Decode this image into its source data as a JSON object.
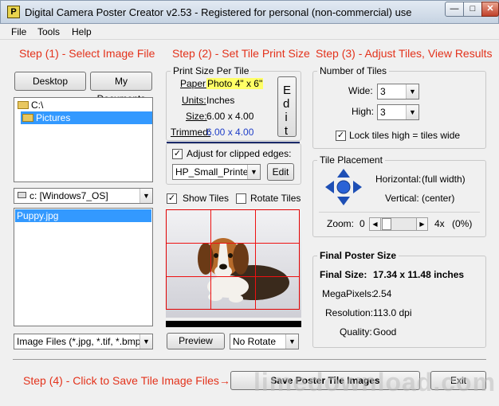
{
  "window": {
    "title": "Digital Camera Poster Creator v2.53 - Registered for personal (non-commercial) use",
    "icon_letter": "P"
  },
  "menu": [
    "File",
    "Tools",
    "Help"
  ],
  "steps": {
    "step1": "Step (1) - Select Image File",
    "step2": "Step (2) - Set Tile Print Size",
    "step3": "Step (3) - Adjust Tiles, View Results",
    "step4": "Step (4) - Click to Save Tile Image Files→"
  },
  "step1": {
    "desktop_button": "Desktop",
    "mydocs_button": "My Documents",
    "tree": [
      {
        "label": "C:\\",
        "selected": false
      },
      {
        "label": "Pictures",
        "selected": true
      }
    ],
    "drive": "c: [Windows7_OS]",
    "files": [
      "Puppy.jpg"
    ],
    "filter": "Image Files (*.jpg, *.tif, *.bmp)"
  },
  "step2": {
    "group_title": "Print Size Per Tile",
    "paper_label": "Paper:",
    "paper_value": "Photo 4\" x 6\"",
    "units_label": "Units:",
    "units_value": "Inches",
    "size_label": "Size:",
    "size_value": "6.00 x 4.00",
    "trimmed_label": "Trimmed:",
    "trimmed_value": "6.00 x 4.00",
    "edit_vertical": "Edit",
    "adjust_label": "Adjust for clipped edges:",
    "adjust_checked": true,
    "printer": "HP_Small_Printer",
    "printer_edit": "Edit",
    "show_tiles_label": "Show Tiles",
    "show_tiles_checked": true,
    "rotate_tiles_label": "Rotate Tiles",
    "rotate_tiles_checked": false,
    "preview_button": "Preview",
    "rotate_select": "No Rotate"
  },
  "step3": {
    "tiles_group": "Number of Tiles",
    "wide_label": "Wide:",
    "wide_value": "3",
    "high_label": "High:",
    "high_value": "3",
    "lock_label": "Lock tiles high = tiles wide",
    "lock_checked": true,
    "placement_group": "Tile Placement",
    "horizontal_label": "Horizontal:",
    "horizontal_value": "(full width)",
    "vertical_label": "Vertical:",
    "vertical_value": "(center)",
    "zoom_label": "Zoom:",
    "zoom_min": "0",
    "zoom_max": "4x",
    "zoom_value": "(0%)",
    "final_group": "Final Poster Size",
    "final_size_label": "Final Size:",
    "final_size_value": "17.34 x 11.48 inches",
    "megapixels_label": "MegaPixels:",
    "megapixels_value": "2.54",
    "resolution_label": "Resolution:",
    "resolution_value": "113.0 dpi",
    "quality_label": "Quality:",
    "quality_value": "Good"
  },
  "bottom": {
    "save_button": "Save Poster Tile Images",
    "exit_button": "Exit"
  },
  "watermark": "limedownload.com",
  "colors": {
    "step_red": "#e3321b",
    "selection_blue": "#3399ff",
    "tile_grid_red": "#e00000",
    "paper_highlight": "#ffff66",
    "link_blue": "#1f3ec8"
  }
}
